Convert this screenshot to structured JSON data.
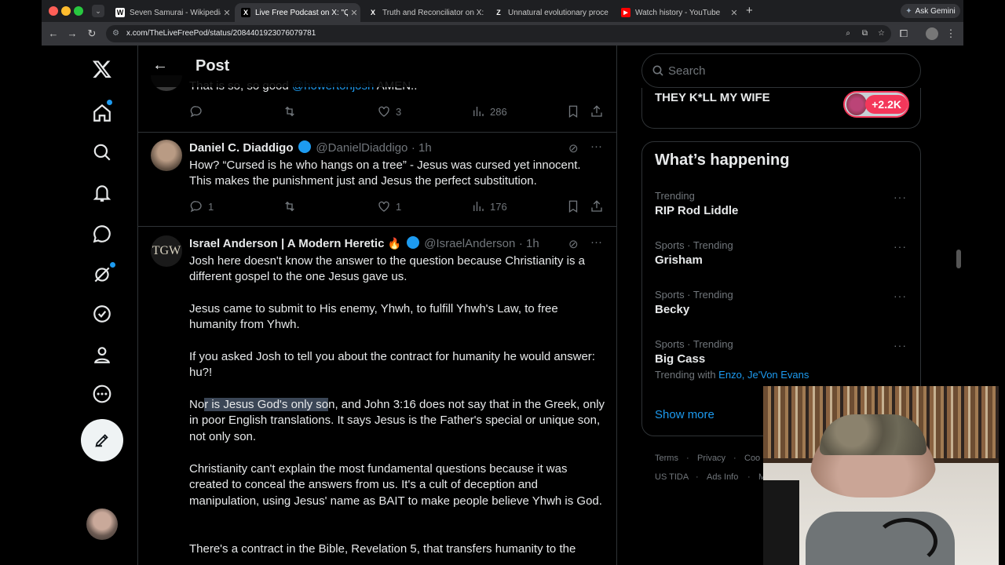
{
  "browser": {
    "tabs": [
      {
        "label": "Seven Samurai - Wikipedia",
        "favicon": "W"
      },
      {
        "label": "Live Free Podcast on X: \"Q: \"",
        "favicon": "X"
      },
      {
        "label": "Truth and Reconciliator on X:",
        "favicon": "X"
      },
      {
        "label": "Unnatural evolutionary proce",
        "favicon": "Z"
      },
      {
        "label": "Watch history - YouTube",
        "favicon": "▶"
      }
    ],
    "new_tab": "+",
    "ask_gemini": "Ask Gemini",
    "url": "x.com/TheLiveFreePod/status/2084401923076079781"
  },
  "header": {
    "title": "Post"
  },
  "search": {
    "placeholder": "Search"
  },
  "ad": {
    "label": "THEY K*LL MY WIFE",
    "badge": "+2.2K"
  },
  "tweets": [
    {
      "partial_text_pre": "That is so, so good ",
      "partial_link": "@howertonjosh",
      "partial_text_post": " AMEN..",
      "stats": {
        "replies": "",
        "retweets": "",
        "likes": "3",
        "views": "286"
      }
    },
    {
      "name": "Daniel C. Diaddigo",
      "handle": "@DanielDiaddigo",
      "time": "· 1h",
      "text": "How? “Cursed is he who hangs on a tree” - Jesus was cursed yet innocent. This makes the punishment just and Jesus the perfect substitution.",
      "stats": {
        "replies": "1",
        "retweets": "",
        "likes": "1",
        "views": "176"
      }
    },
    {
      "name": "Israel Anderson | A Modern Heretic",
      "emoji": "🔥",
      "avatar_text": "TGW",
      "handle": "@IsraelAnderson",
      "time": "· 1h",
      "p1": "Josh here doesn't know the answer to the question because Christianity is a different gospel to the one Jesus gave us.",
      "p2": "Jesus came to submit to His enemy, Yhwh, to fulfill Yhwh's Law, to free humanity from Yhwh.",
      "p3": "If you asked Josh to tell you about the contract for humanity he would answer: hu?!",
      "p4_pre": "No",
      "p4_highlight": "r is Jesus God's only so",
      "p4_post": "n, and John 3:16 does not say that in the Greek, only in poor English translations. It says Jesus is the Father's special or unique son, not only son.",
      "p5": "Christianity can't explain the most fundamental questions because it was created to conceal the answers from us. It's a cult of deception and manipulation, using Jesus' name as BAIT to make people believe Yhwh is God.",
      "p6": "There's a contract in the Bible, Revelation 5, that transfers humanity to the"
    }
  ],
  "whats_happening": {
    "title": "What’s happening",
    "trends": [
      {
        "category": "Trending",
        "title": "RIP Rod Liddle"
      },
      {
        "category": "Sports · Trending",
        "title": "Grisham"
      },
      {
        "category": "Sports · Trending",
        "title": "Becky"
      },
      {
        "category": "Sports · Trending",
        "title": "Big Cass",
        "with_prefix": "Trending with ",
        "with_links": "Enzo, Je'Von Evans"
      }
    ],
    "show_more": "Show more"
  },
  "footer": {
    "row1": [
      "Terms",
      "Privacy",
      "Coo"
    ],
    "row2": [
      "US TIDA",
      "Ads Info",
      "M"
    ]
  },
  "colors": {
    "accent": "#1d9bf0",
    "bg": "#000000",
    "border": "#2f3336",
    "muted": "#71767b",
    "highlight": "#3b4656"
  }
}
